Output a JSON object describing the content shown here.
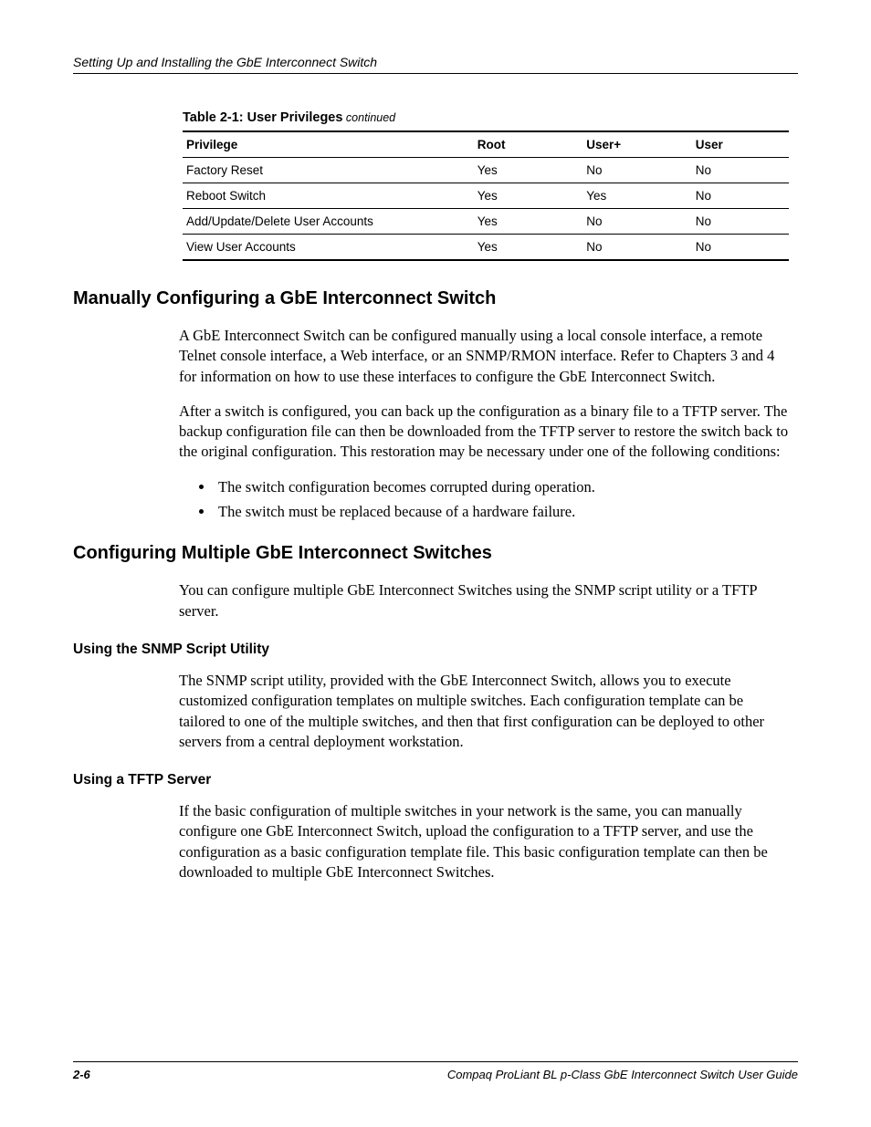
{
  "header": {
    "chapter_title": "Setting Up and Installing the GbE Interconnect Switch"
  },
  "table": {
    "caption_prefix": "Table 2-1:  User Privileges",
    "caption_suffix": " continued",
    "columns": [
      "Privilege",
      "Root",
      "User+",
      "User"
    ],
    "rows": [
      {
        "priv": "Factory Reset",
        "root": "Yes",
        "userplus": "No",
        "user": "No"
      },
      {
        "priv": "Reboot Switch",
        "root": "Yes",
        "userplus": "Yes",
        "user": "No"
      },
      {
        "priv": "Add/Update/Delete User Accounts",
        "root": "Yes",
        "userplus": "No",
        "user": "No"
      },
      {
        "priv": "View User Accounts",
        "root": "Yes",
        "userplus": "No",
        "user": "No"
      }
    ]
  },
  "sections": {
    "s1_heading": "Manually Configuring a GbE Interconnect Switch",
    "s1_p1": "A GbE Interconnect Switch can be configured manually using a local console interface, a remote Telnet console interface, a Web interface, or an SNMP/RMON interface. Refer to Chapters 3 and 4 for information on how to use these interfaces to configure the GbE Interconnect Switch.",
    "s1_p2": "After a switch is configured, you can back up the configuration as a binary file to a TFTP server. The backup configuration file can then be downloaded from the TFTP server to restore the switch back to the original configuration. This restoration may be necessary under one of the following conditions:",
    "s1_bullets": [
      "The switch configuration becomes corrupted during operation.",
      "The switch must be replaced because of a hardware failure."
    ],
    "s2_heading": "Configuring Multiple GbE Interconnect Switches",
    "s2_p1": "You can configure multiple GbE Interconnect Switches using the SNMP script utility or a TFTP server.",
    "s2_sub1_heading": "Using the SNMP Script Utility",
    "s2_sub1_p1": "The SNMP script utility, provided with the GbE Interconnect Switch, allows you to execute customized configuration templates on multiple switches. Each configuration template can be tailored to one of the multiple switches, and then that first configuration can be deployed to other servers from a central deployment workstation.",
    "s2_sub2_heading": "Using a TFTP Server",
    "s2_sub2_p1": "If the basic configuration of multiple switches in your network is the same, you can manually configure one GbE Interconnect Switch, upload the configuration to a TFTP server, and use the configuration as a basic configuration template file. This basic configuration template can then be downloaded to multiple GbE Interconnect Switches."
  },
  "footer": {
    "page_number": "2-6",
    "doc_title": "Compaq ProLiant BL p-Class GbE Interconnect Switch User Guide"
  }
}
